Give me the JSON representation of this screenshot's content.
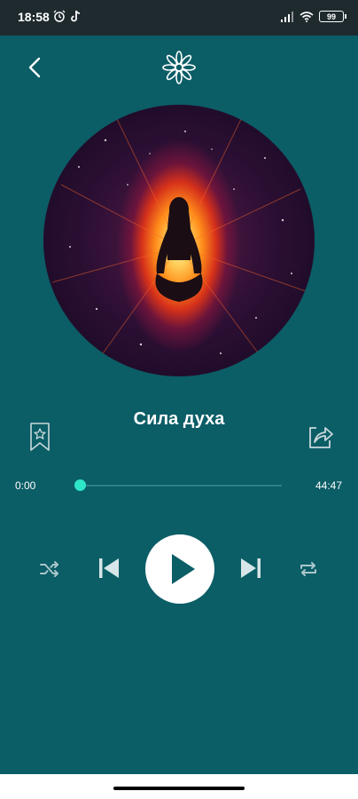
{
  "status_bar": {
    "time": "18:58",
    "battery": "99"
  },
  "player": {
    "title": "Сила духа",
    "current_time": "0:00",
    "total_time": "44:47",
    "progress": 0.0
  },
  "icons": {
    "back": "chevron-left-icon",
    "logo": "mandala-logo-icon",
    "bookmark": "bookmark-star-icon",
    "share": "share-icon",
    "shuffle": "shuffle-icon",
    "previous": "skip-previous-icon",
    "play": "play-icon",
    "next": "skip-next-icon",
    "repeat": "repeat-icon"
  },
  "colors": {
    "background": "#0b5d66",
    "accent": "#2ee6c8",
    "status_bar": "#1e2a2e"
  }
}
